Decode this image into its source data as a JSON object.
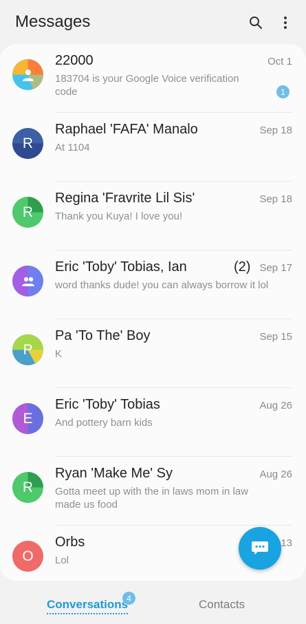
{
  "header": {
    "title": "Messages",
    "icons": [
      "search-icon",
      "more-options-icon"
    ]
  },
  "conversations": [
    {
      "name": "22000",
      "snippet": "183704 is your Google Voice verification code",
      "date": "Oct 1",
      "unread": "1",
      "avatar": {
        "type": "person-icon",
        "colors": [
          "#f7b733",
          "#fc7e3a",
          "#44c3ef"
        ]
      }
    },
    {
      "name": "Raphael 'FAFA' Manalo",
      "snippet": "At 1104",
      "date": "Sep 18",
      "avatar": {
        "letter": "R",
        "colors": [
          "#3c5fa5",
          "#2f4a8e"
        ]
      }
    },
    {
      "name": "Regina 'Fravrite Lil Sis'",
      "snippet": "Thank you Kuya! I love you!",
      "date": "Sep 18",
      "avatar": {
        "letter": "R",
        "colors": [
          "#4ec96c",
          "#2e9e4f"
        ]
      }
    },
    {
      "name": "Eric 'Toby' Tobias, Ian",
      "count": "(2)",
      "snippet": "word thanks dude! you can always borrow it lol",
      "date": "Sep 17",
      "avatar": {
        "type": "group-icon",
        "colors": [
          "#a45ee5",
          "#6f7ff0"
        ]
      }
    },
    {
      "name": "Pa 'To The' Boy",
      "snippet": "K",
      "date": "Sep 15",
      "avatar": {
        "letter": "P",
        "colors": [
          "#a6d64a",
          "#4aa0c8",
          "#e8d23a"
        ]
      }
    },
    {
      "name": "Eric 'Toby' Tobias",
      "snippet": "And pottery barn kids",
      "date": "Aug 26",
      "avatar": {
        "letter": "E",
        "colors": [
          "#b05ad8",
          "#6a6fe0"
        ]
      }
    },
    {
      "name": "Ryan 'Make Me' Sy",
      "snippet": "Gotta meet up with the in laws mom in law made us food",
      "date": "Aug 26",
      "avatar": {
        "letter": "R",
        "colors": [
          "#4ec96c",
          "#2e9e4f"
        ]
      }
    },
    {
      "name": "Orbs",
      "snippet": "Lol",
      "date": "13",
      "avatar": {
        "letter": "O",
        "colors": [
          "#f06a6a",
          "#e24d4d"
        ]
      }
    }
  ],
  "fab": {
    "icon": "compose-chat-icon",
    "color": "#19a3e0"
  },
  "bottom_tabs": {
    "conversations": "Conversations",
    "conversations_badge": "4",
    "contacts": "Contacts"
  },
  "accent_color": "#1e9ad6"
}
